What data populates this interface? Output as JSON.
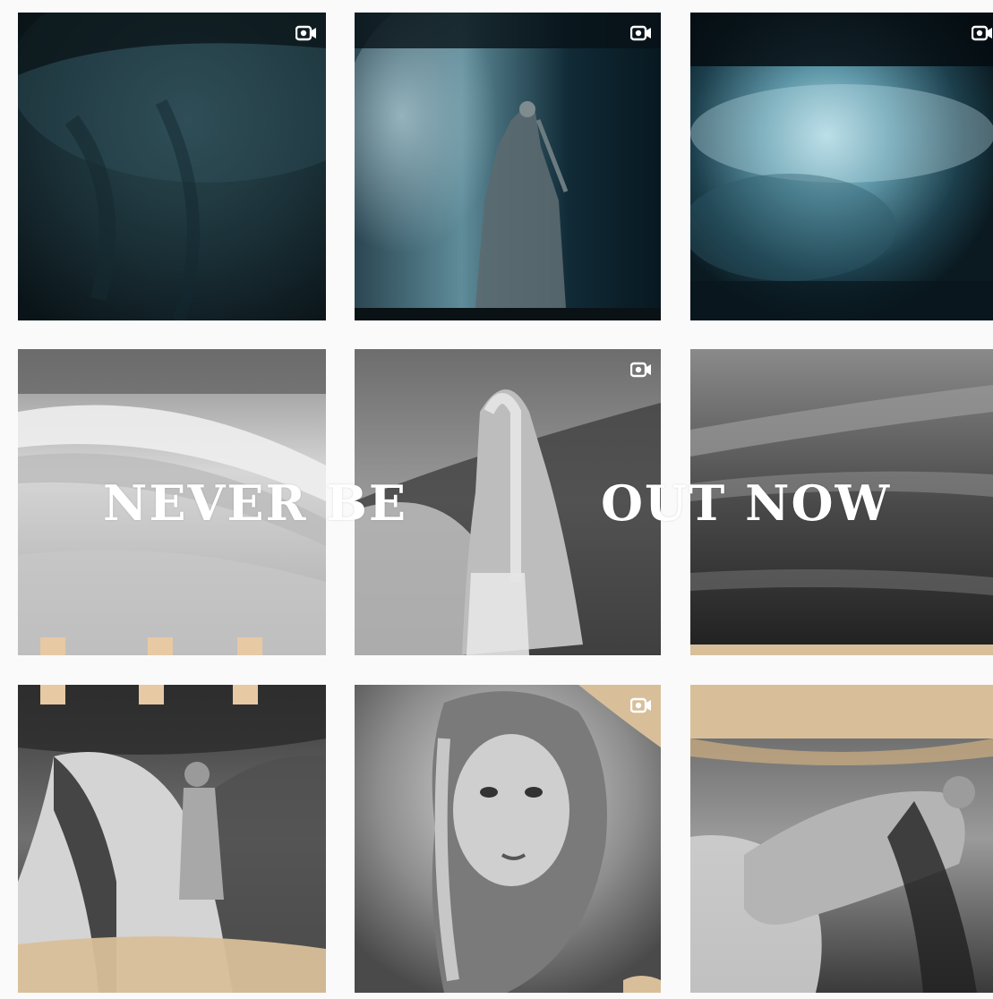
{
  "overlay": {
    "left_text": "NEVER BE",
    "right_text": "OUT NOW"
  },
  "icons": {
    "video": "video-camera-icon"
  },
  "tiles": [
    {
      "id": "r1c1",
      "description_name": "dark-fur-texture",
      "has_video_icon": true
    },
    {
      "id": "r1c2",
      "description_name": "dancer-in-smoke",
      "has_video_icon": true
    },
    {
      "id": "r1c3",
      "description_name": "blue-smoke-cloud",
      "has_video_icon": true
    },
    {
      "id": "r2c1",
      "description_name": "blurred-hair-left",
      "has_video_icon": false
    },
    {
      "id": "r2c2",
      "description_name": "woman-back-view",
      "has_video_icon": true
    },
    {
      "id": "r2c3",
      "description_name": "blurred-hair-right",
      "has_video_icon": false
    },
    {
      "id": "r3c1",
      "description_name": "woman-with-horse",
      "has_video_icon": false
    },
    {
      "id": "r3c2",
      "description_name": "woman-portrait-braids",
      "has_video_icon": true
    },
    {
      "id": "r3c3",
      "description_name": "woman-reclining",
      "has_video_icon": false
    }
  ],
  "colors": {
    "background": "#fafafa",
    "gold": "#d8bf9a",
    "white": "#ffffff"
  }
}
